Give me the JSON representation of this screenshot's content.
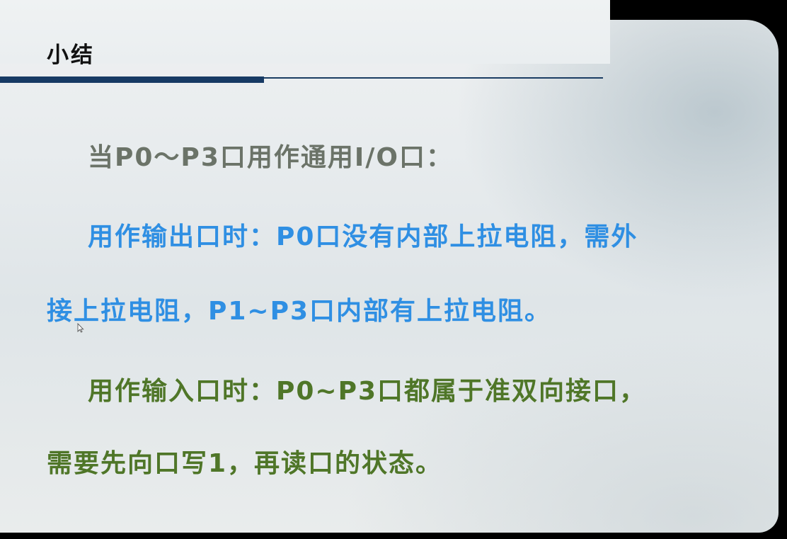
{
  "slide": {
    "title": "小结",
    "lines": [
      "当P0～P3口用作通用I/O口：",
      "用作输出口时：P0口没有内部上拉电阻，需外",
      "接上拉电阻，P1~P3口内部有上拉电阻。",
      "用作输入口时：P0~P3口都属于准双向接口，",
      "需要先向口写1，再读口的状态。"
    ]
  },
  "colors": {
    "heading": "#6b7368",
    "output_text": "#2f8fe3",
    "input_text": "#4f7628",
    "rule": "#173a64"
  },
  "icons": {
    "cursor": "mouse-pointer-icon"
  }
}
